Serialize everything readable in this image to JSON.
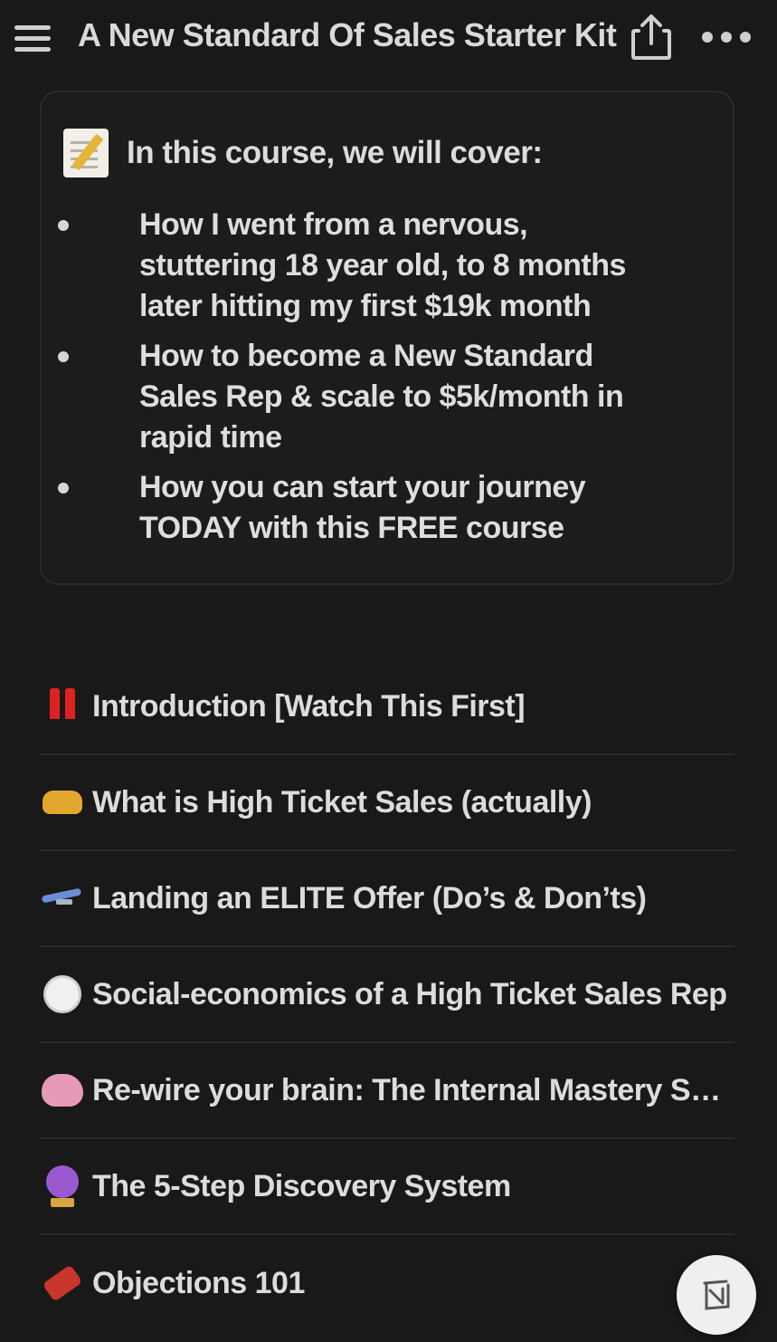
{
  "topbar": {
    "title": "A New Standard Of Sales Starter Kit",
    "menu_icon": "hamburger-menu-icon",
    "share_icon": "share-icon",
    "more_icon": "more-dots-icon"
  },
  "callout": {
    "icon": "memo-icon",
    "title": "In this course, we will cover:",
    "bullets": [
      "How I went from a nervous, stuttering 18 year old, to 8 months later hitting my first $19k month",
      "How to become a New Standard Sales Rep & scale to $5k/month in rapid time",
      "How you can start your journey TODAY with this FREE course"
    ]
  },
  "lessons": [
    {
      "icon": "double-exclamation-icon",
      "label": "Introduction [Watch This First]"
    },
    {
      "icon": "handshake-icon",
      "label": "What is High Ticket Sales (actually)"
    },
    {
      "icon": "airplane-icon",
      "label": "Landing an ELITE Offer (Do’s & Don’ts)"
    },
    {
      "icon": "clock-icon",
      "label": "Social-economics of a High Ticket Sales Rep"
    },
    {
      "icon": "brain-icon",
      "label": "Re-wire your brain: The Internal Mastery System"
    },
    {
      "icon": "crystal-ball-icon",
      "label": "The 5-Step Discovery System"
    },
    {
      "icon": "firecracker-icon",
      "label": "Objections 101"
    }
  ],
  "fab": {
    "icon": "notion-logo-icon"
  }
}
